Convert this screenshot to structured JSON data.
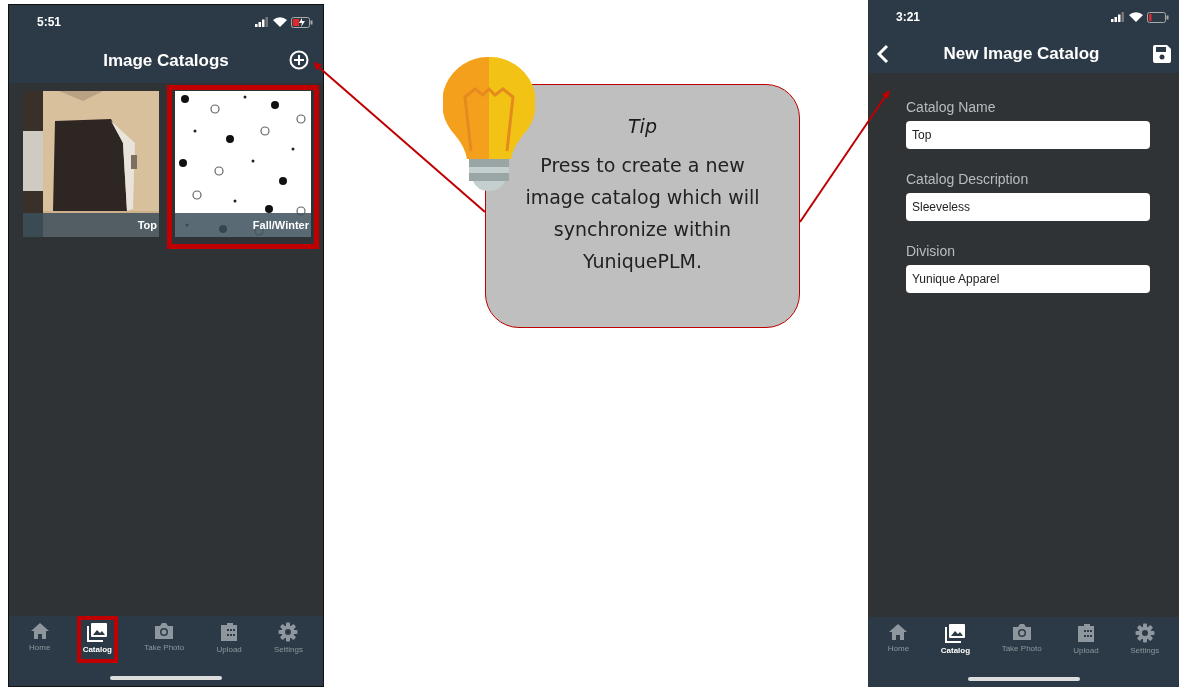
{
  "left_phone": {
    "status": {
      "time": "5:51",
      "charging": true
    },
    "title": "Image Catalogs",
    "catalogs": [
      {
        "label": "Top",
        "highlighted": false
      },
      {
        "label": "Fall/Winter",
        "kind": "pattern",
        "highlighted": true
      }
    ],
    "tabs": [
      {
        "label": "Home",
        "kind": "home",
        "selected": false,
        "highlighted": false
      },
      {
        "label": "Catalog",
        "kind": "catalog",
        "selected": true,
        "highlighted": true
      },
      {
        "label": "Take Photo",
        "kind": "camera",
        "selected": false,
        "highlighted": false
      },
      {
        "label": "Upload",
        "kind": "upload",
        "selected": false,
        "highlighted": false
      },
      {
        "label": "Settings",
        "kind": "settings",
        "selected": false,
        "highlighted": false
      }
    ]
  },
  "tip": {
    "title": "Tip",
    "text": "Press to create a new image catalog which will synchronize within YuniquePLM."
  },
  "right_phone": {
    "status": {
      "time": "3:21",
      "charging": false
    },
    "title": "New Image Catalog",
    "fields": [
      {
        "label": "Catalog Name",
        "value": "Top"
      },
      {
        "label": "Catalog Description",
        "value": "Sleeveless"
      },
      {
        "label": "Division",
        "value": "Yunique Apparel"
      }
    ],
    "tabs": [
      {
        "label": "Home",
        "kind": "home",
        "selected": false,
        "highlighted": false
      },
      {
        "label": "Catalog",
        "kind": "catalog",
        "selected": true,
        "highlighted": false
      },
      {
        "label": "Take Photo",
        "kind": "camera",
        "selected": false,
        "highlighted": false
      },
      {
        "label": "Upload",
        "kind": "upload",
        "selected": false,
        "highlighted": false
      },
      {
        "label": "Settings",
        "kind": "settings",
        "selected": false,
        "highlighted": false
      }
    ]
  }
}
